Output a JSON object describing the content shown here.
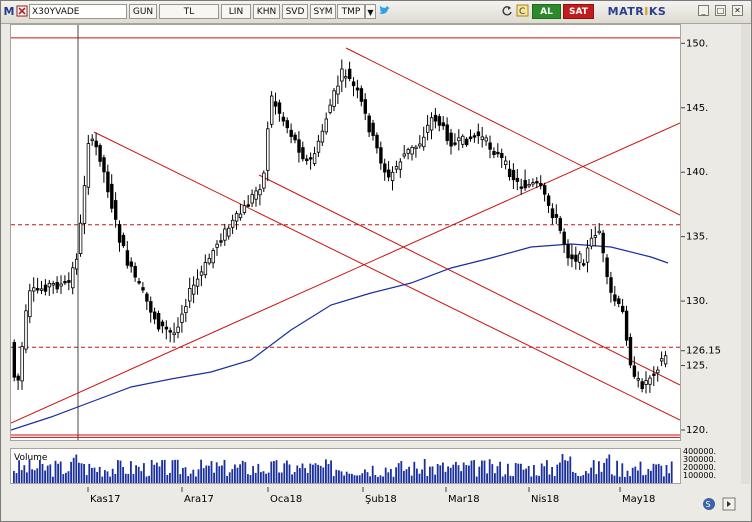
{
  "toolbar": {
    "symbol": "X30YVADE",
    "period": "GUN",
    "currency": "TL",
    "scale": "LIN",
    "buttons": [
      "KHN",
      "SVD",
      "SYM",
      "TMP"
    ],
    "buy": "AL",
    "sell": "SAT",
    "brand": "MATRIKS",
    "brand_accent": "#d3a214"
  },
  "colors": {
    "candle": "#000000",
    "channel": "#cc1111",
    "ma": "#1a2fa0",
    "volume": "#1a2fa0",
    "buy": "#2c8a2c",
    "sell": "#c21d1d"
  },
  "chart_data": {
    "type": "candlestick",
    "y_ticks": [
      "150.",
      "145.",
      "140.",
      "135.",
      "130.",
      "125.",
      "120."
    ],
    "last_price": "126.15",
    "ylim": [
      119.3,
      151.5
    ],
    "x_ticks": [
      "Kas17",
      "Ara17",
      "Oca18",
      "Şub18",
      "Mar18",
      "Nis18",
      "May18"
    ],
    "horizontal_levels": [
      150.5,
      136,
      126.5,
      119.5
    ],
    "volume": {
      "label": "Volume",
      "ticks": [
        "400000.",
        "300000.",
        "200000.",
        "100000."
      ]
    }
  }
}
